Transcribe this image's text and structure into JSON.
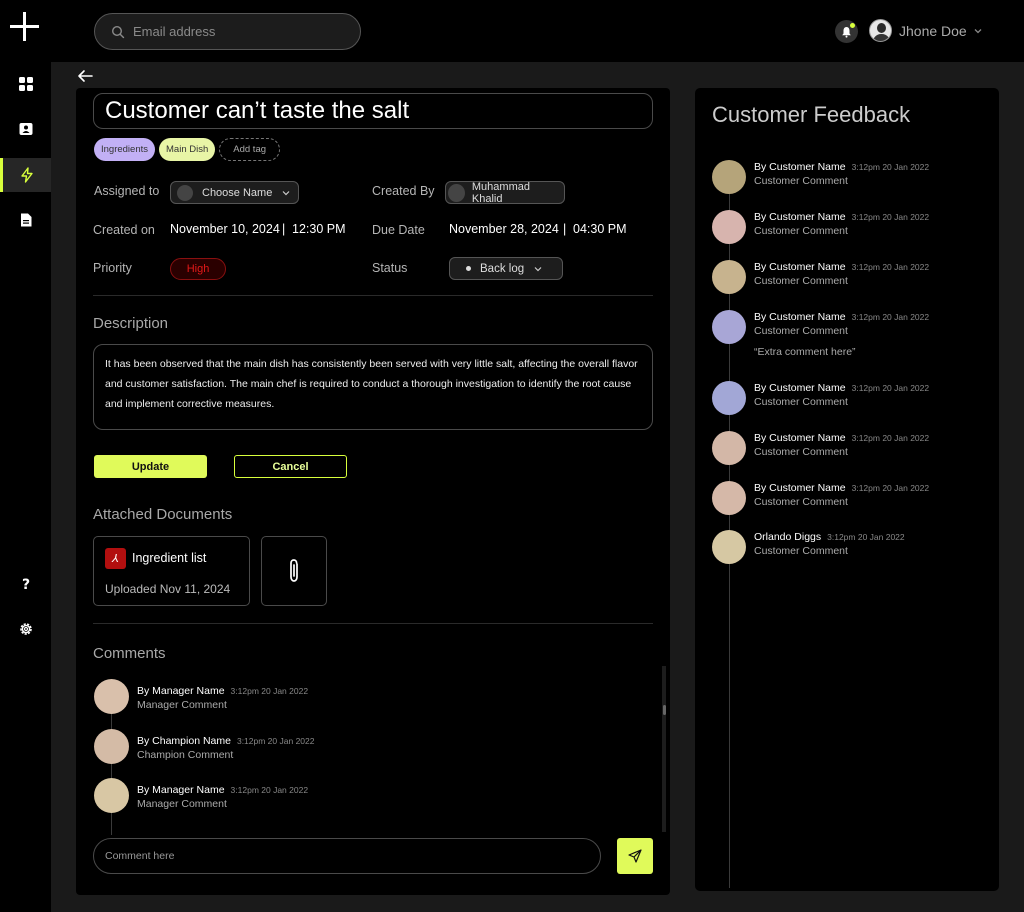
{
  "colors": {
    "accent": "#E0FA5A",
    "priority_high": "#E31818",
    "tag_ingredients": "#C2B0F5",
    "tag_main_dish": "#E8F5A6"
  },
  "sidebar": {
    "items": [
      {
        "icon": "grid-icon"
      },
      {
        "icon": "user-card-icon"
      },
      {
        "icon": "lightning-icon",
        "active": true
      },
      {
        "icon": "document-icon"
      },
      {
        "icon": "help-icon",
        "label": "?"
      },
      {
        "icon": "gear-icon"
      }
    ]
  },
  "topbar": {
    "search_placeholder": "Email address",
    "user_name": "Jhone Doe"
  },
  "ticket": {
    "title": "Customer can’t taste the salt",
    "tags": [
      "Ingredients",
      "Main Dish"
    ],
    "add_tag_label": "Add tag",
    "assigned_to_label": "Assigned to",
    "assigned_to_value": "Choose Name",
    "created_by_label": "Created By",
    "created_by_value": "Muhammad Khalid",
    "created_on_label": "Created on",
    "created_on_date": "November 10, 2024",
    "created_on_time": "12:30 PM",
    "due_date_label": "Due Date",
    "due_date_date": "November 28, 2024",
    "due_date_time": "04:30 PM",
    "priority_label": "Priority",
    "priority_value": "High",
    "status_label": "Status",
    "status_value": "Back log",
    "description_heading": "Description",
    "description_text": "It has been observed that the main dish has consistently been served with very little salt, affecting the overall flavor and customer satisfaction. The main chef is required to conduct a thorough investigation to identify the root cause and implement corrective measures.",
    "update_label": "Update",
    "cancel_label": "Cancel",
    "attached_heading": "Attached Documents",
    "document_name": "Ingredient list",
    "document_uploaded": "Uploaded Nov 11, 2024",
    "comments_heading": "Comments",
    "comments": [
      {
        "name": "By Manager Name",
        "time": "3:12pm 20 Jan 2022",
        "text": "Manager Comment"
      },
      {
        "name": "By Champion Name",
        "time": "3:12pm 20 Jan 2022",
        "text": "Champion Comment"
      },
      {
        "name": "By Manager Name",
        "time": "3:12pm 20 Jan 2022",
        "text": "Manager Comment"
      }
    ],
    "comment_placeholder": "Comment here"
  },
  "feedback": {
    "heading": "Customer Feedback",
    "items": [
      {
        "name": "By Customer Name",
        "time": "3:12pm 20 Jan 2022",
        "text": "Customer Comment",
        "color": "#B5A47A"
      },
      {
        "name": "By Customer Name",
        "time": "3:12pm 20 Jan 2022",
        "text": "Customer Comment",
        "color": "#D7B4AE"
      },
      {
        "name": "By Customer Name",
        "time": "3:12pm 20 Jan 2022",
        "text": "Customer Comment",
        "color": "#C7B38E"
      },
      {
        "name": "By Customer Name",
        "time": "3:12pm 20 Jan 2022",
        "text": "Customer Comment",
        "color": "#A8A6D6"
      },
      {
        "name": "By Customer Name",
        "time": "3:12pm 20 Jan 2022",
        "text": "Customer Comment",
        "color": "#A2A7D6"
      },
      {
        "name": "By Customer Name",
        "time": "3:12pm 20 Jan 2022",
        "text": "Customer Comment",
        "color": "#D3B7A7"
      },
      {
        "name": "By Customer Name",
        "time": "3:12pm 20 Jan 2022",
        "text": "Customer Comment",
        "color": "#D5B8A8"
      },
      {
        "name": "Orlando Diggs",
        "time": "3:12pm 20 Jan 2022",
        "text": "Customer Comment",
        "color": "#D6C8A3"
      }
    ],
    "extra_comment": "“Extra comment here”"
  }
}
